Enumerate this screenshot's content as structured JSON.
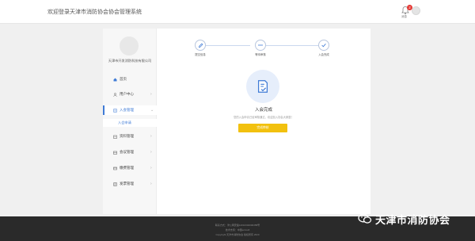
{
  "header": {
    "title": "欢迎登录天津市消防协会协会管理系统",
    "notification_count": "2",
    "notification_label": "消息"
  },
  "sidebar": {
    "company_name": "天津市开发消防科技有限公司",
    "items": [
      {
        "label": "首页",
        "icon": "home-icon"
      },
      {
        "label": "用户中心",
        "icon": "user-icon"
      },
      {
        "label": "入会管理",
        "icon": "document-icon",
        "active": true
      },
      {
        "label": "资料管理",
        "icon": "folder-icon"
      },
      {
        "label": "会议管理",
        "icon": "calendar-icon"
      },
      {
        "label": "缴费管理",
        "icon": "payment-icon"
      },
      {
        "label": "发票管理",
        "icon": "invoice-icon"
      }
    ],
    "sub_item": "入会申请"
  },
  "steps": [
    {
      "label": "提交信息",
      "icon": "pencil-icon"
    },
    {
      "label": "等待审核",
      "icon": "ellipsis-icon"
    },
    {
      "label": "入会完成",
      "icon": "check-icon"
    }
  ],
  "result": {
    "icon": "document-check-icon",
    "title": "入会完成",
    "description": "您的入会申请已经审核通过，欢迎加入协会大家庭！",
    "button_label": "完成审核"
  },
  "footer": {
    "line1": "联系方式：津公网安备12010302000458号",
    "line2": "技术支持：中国eccsoft",
    "line3": "Copyright 天津市消防协会 版权所有 2020"
  },
  "watermark": {
    "text": "天津市消防协会"
  },
  "colors": {
    "accent": "#3f7bd6",
    "button": "#f2c10f",
    "footer": "#2a2a2a",
    "badge": "#e53935"
  }
}
